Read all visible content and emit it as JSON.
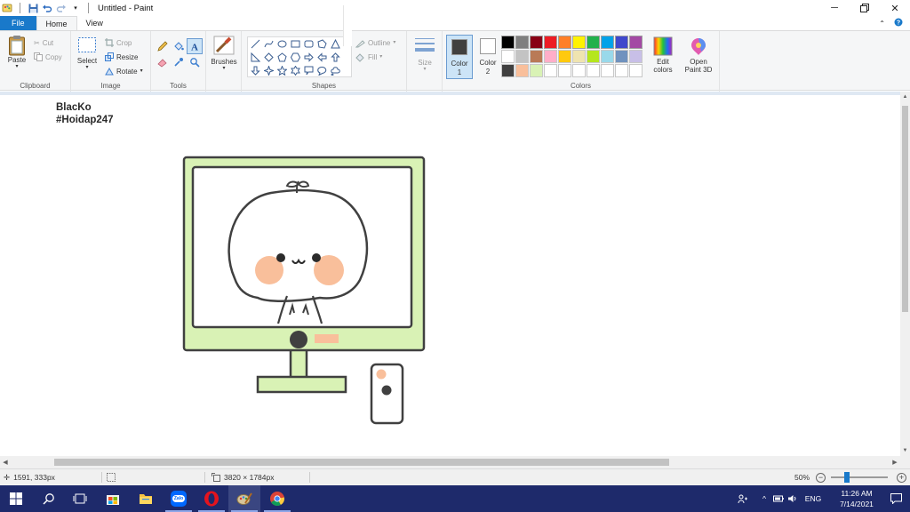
{
  "window": {
    "title": "Untitled - Paint"
  },
  "tabs": {
    "file": "File",
    "home": "Home",
    "view": "View"
  },
  "ribbon": {
    "clipboard": {
      "group": "Clipboard",
      "paste": "Paste",
      "cut": "Cut",
      "copy": "Copy"
    },
    "image": {
      "group": "Image",
      "select": "Select",
      "crop": "Crop",
      "resize": "Resize",
      "rotate": "Rotate"
    },
    "tools": {
      "group": "Tools"
    },
    "brushes": {
      "label": "Brushes"
    },
    "shapes": {
      "group": "Shapes",
      "outline": "Outline",
      "fill": "Fill"
    },
    "size": {
      "label": "Size"
    },
    "colors": {
      "group": "Colors",
      "color1": "Color 1",
      "color2": "Color 2",
      "color1_value": "#404040",
      "color2_value": "#ffffff",
      "edit_colors": "Edit colors",
      "open_paint3d": "Open Paint 3D",
      "palette_row1": [
        "#000000",
        "#7f7f7f",
        "#880015",
        "#ed1c24",
        "#ff7f27",
        "#fff200",
        "#22b14c",
        "#00a2e8",
        "#3f48cc",
        "#a349a4"
      ],
      "palette_row2": [
        "#ffffff",
        "#c3c3c3",
        "#b97a57",
        "#ffaec9",
        "#ffc90e",
        "#efe4b0",
        "#b5e61d",
        "#99d9ea",
        "#7092be",
        "#c8bfe7"
      ],
      "palette_row3": [
        "#404040",
        "#f9bf9b",
        "#d9f2b5",
        "#ffffff",
        "#ffffff",
        "#ffffff",
        "#ffffff",
        "#ffffff",
        "#ffffff",
        "#ffffff"
      ]
    }
  },
  "canvas": {
    "text_line1": "BlacKo",
    "text_line2": "#Hoidap247"
  },
  "status": {
    "cursor_pos": "1591, 333px",
    "image_size": "3820 × 1784px",
    "zoom": "50%"
  },
  "taskbar": {
    "pinned": [
      "start",
      "search",
      "task-view",
      "store",
      "file-explorer",
      "zalo",
      "opera",
      "paint-app",
      "chrome"
    ],
    "zalo_label": "Zalo",
    "language": "ENG",
    "time": "11:26 AM",
    "date": "7/14/2021"
  }
}
